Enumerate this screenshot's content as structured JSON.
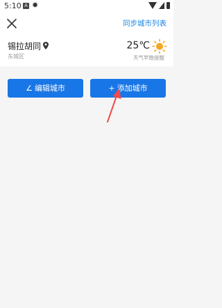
{
  "status": {
    "time": "5:10",
    "notif_letter": "A"
  },
  "header": {
    "sync_label": "同步城市列表"
  },
  "city": {
    "name": "锡拉胡同",
    "district": "东城区",
    "temperature": "25℃",
    "note": "天气早晚提醒"
  },
  "buttons": {
    "edit_label": "编辑城市",
    "add_label": "添加城市"
  },
  "colors": {
    "accent": "#1976e6",
    "link": "#1e88e5",
    "sun": "#f5a623",
    "annotation": "#f04a4a"
  }
}
